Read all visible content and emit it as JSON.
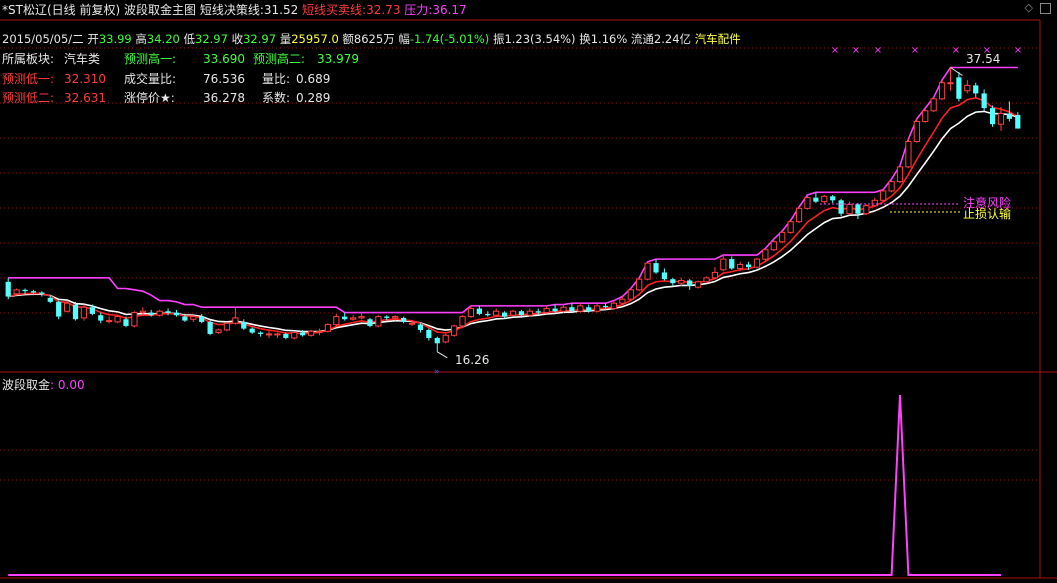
{
  "header": {
    "stock": "*ST松辽(日线 前复权)",
    "indicator": "波段取金主图",
    "decision_label": "短线决策线:",
    "decision_value": "31.52",
    "buysell_label": "短线买卖线:",
    "buysell_value": "32.73",
    "pressure_label": "压力:",
    "pressure_value": "36.17"
  },
  "quote": {
    "date": "2015/05/05/二",
    "open_label": "开",
    "open": "33.99",
    "high_label": "高",
    "high": "34.20",
    "low_label": "低",
    "low": "32.97",
    "close_label": "收",
    "close": "32.97",
    "volume_label": "量",
    "volume": "25957.0",
    "amount_label": "额",
    "amount": "8625万",
    "change_label": "幅",
    "change": "-1.74(-5.01%)",
    "amplitude_label": "振",
    "amplitude": "1.23(3.54%)",
    "turnover_label": "换",
    "turnover": "1.16%",
    "float_label": "流通",
    "float": "2.24亿",
    "sector": "汽车配件"
  },
  "info": {
    "board_label": "所属板块:",
    "board": "汽车类",
    "pred_high1_label": "预测高一:",
    "pred_high1": "33.690",
    "pred_high2_label": "预测高二:",
    "pred_high2": "33.979",
    "pred_low1_label": "预测低一:",
    "pred_low1": "32.310",
    "volratio_label": "成交量比:",
    "volratio": "76.536",
    "qb_label": "量比:",
    "qb": "0.689",
    "pred_low2_label": "预测低二:",
    "pred_low2": "32.631",
    "limitup_label": "涨停价★:",
    "limitup": "36.278",
    "coef_label": "系数:",
    "coef": "0.289"
  },
  "annotations": {
    "max_price": "37.54",
    "min_price": "16.26",
    "risk": "注意风险",
    "stoploss": "止损认输"
  },
  "sub_panel": {
    "label": "波段取金",
    "value": ": 0.00"
  },
  "colors": {
    "up": "#ff4040",
    "down": "#54ffff",
    "pressure_line": "#ff40ff",
    "buysell_line": "#ff2020",
    "decision_line": "#ffffff",
    "signal_line": "#ff40ff"
  },
  "chart_data": {
    "type": "candlestick",
    "ylim": [
      15.5,
      39
    ],
    "candles": [
      {
        "o": 21.5,
        "c": 20.4,
        "h": 21.8,
        "l": 20.2
      },
      {
        "o": 20.6,
        "c": 20.9,
        "h": 21.0,
        "l": 20.5
      },
      {
        "o": 20.9,
        "c": 20.8,
        "h": 21.0,
        "l": 20.6
      },
      {
        "o": 20.8,
        "c": 20.7,
        "h": 20.9,
        "l": 20.5
      },
      {
        "o": 20.7,
        "c": 20.6,
        "h": 20.8,
        "l": 20.4
      },
      {
        "o": 20.3,
        "c": 20.0,
        "h": 20.5,
        "l": 19.9
      },
      {
        "o": 20.0,
        "c": 18.9,
        "h": 20.1,
        "l": 18.7
      },
      {
        "o": 19.3,
        "c": 19.9,
        "h": 20.1,
        "l": 19.2
      },
      {
        "o": 19.8,
        "c": 18.7,
        "h": 20.0,
        "l": 18.6
      },
      {
        "o": 18.8,
        "c": 19.6,
        "h": 19.8,
        "l": 18.6
      },
      {
        "o": 19.6,
        "c": 19.1,
        "h": 19.8,
        "l": 19.0
      },
      {
        "o": 19.0,
        "c": 18.6,
        "h": 19.2,
        "l": 18.4
      },
      {
        "o": 18.6,
        "c": 18.6,
        "h": 18.9,
        "l": 18.4
      },
      {
        "o": 18.5,
        "c": 18.9,
        "h": 19.0,
        "l": 18.4
      },
      {
        "o": 18.7,
        "c": 18.2,
        "h": 18.9,
        "l": 18.1
      },
      {
        "o": 18.2,
        "c": 19.2,
        "h": 19.3,
        "l": 18.1
      },
      {
        "o": 19.2,
        "c": 19.3,
        "h": 19.6,
        "l": 19.0
      },
      {
        "o": 19.2,
        "c": 19.0,
        "h": 19.4,
        "l": 18.9
      },
      {
        "o": 19.0,
        "c": 19.3,
        "h": 19.4,
        "l": 18.9
      },
      {
        "o": 19.3,
        "c": 19.2,
        "h": 19.5,
        "l": 19.0
      },
      {
        "o": 19.2,
        "c": 19.0,
        "h": 19.4,
        "l": 18.9
      },
      {
        "o": 18.9,
        "c": 18.6,
        "h": 19.1,
        "l": 18.5
      },
      {
        "o": 18.7,
        "c": 18.9,
        "h": 19.0,
        "l": 18.5
      },
      {
        "o": 18.9,
        "c": 18.5,
        "h": 19.1,
        "l": 18.4
      },
      {
        "o": 18.5,
        "c": 17.6,
        "h": 18.6,
        "l": 17.5
      },
      {
        "o": 17.7,
        "c": 17.9,
        "h": 18.0,
        "l": 17.6
      },
      {
        "o": 17.9,
        "c": 18.4,
        "h": 18.5,
        "l": 17.8
      },
      {
        "o": 18.4,
        "c": 18.8,
        "h": 19.6,
        "l": 18.3
      },
      {
        "o": 18.5,
        "c": 18.0,
        "h": 18.7,
        "l": 17.9
      },
      {
        "o": 18.0,
        "c": 17.7,
        "h": 18.1,
        "l": 17.6
      },
      {
        "o": 17.7,
        "c": 17.6,
        "h": 17.8,
        "l": 17.4
      },
      {
        "o": 17.6,
        "c": 17.6,
        "h": 17.8,
        "l": 17.3
      },
      {
        "o": 17.6,
        "c": 17.6,
        "h": 17.7,
        "l": 17.3
      },
      {
        "o": 17.6,
        "c": 17.3,
        "h": 17.7,
        "l": 17.2
      },
      {
        "o": 17.3,
        "c": 17.7,
        "h": 17.8,
        "l": 17.2
      },
      {
        "o": 17.7,
        "c": 17.5,
        "h": 17.9,
        "l": 17.4
      },
      {
        "o": 17.5,
        "c": 17.8,
        "h": 17.9,
        "l": 17.4
      },
      {
        "o": 17.8,
        "c": 17.8,
        "h": 18.0,
        "l": 17.5
      },
      {
        "o": 17.8,
        "c": 18.3,
        "h": 18.4,
        "l": 17.7
      },
      {
        "o": 18.3,
        "c": 18.9,
        "h": 19.1,
        "l": 18.2
      },
      {
        "o": 18.9,
        "c": 18.7,
        "h": 19.2,
        "l": 18.6
      },
      {
        "o": 18.7,
        "c": 18.8,
        "h": 19.0,
        "l": 18.6
      },
      {
        "o": 18.8,
        "c": 18.9,
        "h": 19.2,
        "l": 18.7
      },
      {
        "o": 18.7,
        "c": 18.2,
        "h": 18.8,
        "l": 18.1
      },
      {
        "o": 18.2,
        "c": 18.9,
        "h": 19.0,
        "l": 18.1
      },
      {
        "o": 18.9,
        "c": 18.8,
        "h": 19.0,
        "l": 18.6
      },
      {
        "o": 18.8,
        "c": 18.9,
        "h": 19.0,
        "l": 18.6
      },
      {
        "o": 18.8,
        "c": 18.5,
        "h": 18.9,
        "l": 18.4
      },
      {
        "o": 18.4,
        "c": 18.4,
        "h": 18.6,
        "l": 18.2
      },
      {
        "o": 18.3,
        "c": 17.9,
        "h": 18.4,
        "l": 17.7
      },
      {
        "o": 17.9,
        "c": 17.3,
        "h": 18.0,
        "l": 17.1
      },
      {
        "o": 17.3,
        "c": 16.9,
        "h": 17.4,
        "l": 16.26
      },
      {
        "o": 17.0,
        "c": 17.5,
        "h": 17.6,
        "l": 16.9
      },
      {
        "o": 17.5,
        "c": 18.2,
        "h": 18.3,
        "l": 17.4
      },
      {
        "o": 18.2,
        "c": 18.9,
        "h": 19.0,
        "l": 18.1
      },
      {
        "o": 18.9,
        "c": 19.5,
        "h": 19.7,
        "l": 18.8
      },
      {
        "o": 19.5,
        "c": 19.1,
        "h": 19.7,
        "l": 19.0
      },
      {
        "o": 19.1,
        "c": 19.0,
        "h": 19.3,
        "l": 18.9
      },
      {
        "o": 19.0,
        "c": 19.3,
        "h": 19.5,
        "l": 18.9
      },
      {
        "o": 19.2,
        "c": 18.9,
        "h": 19.3,
        "l": 18.8
      },
      {
        "o": 19.0,
        "c": 19.3,
        "h": 19.4,
        "l": 18.9
      },
      {
        "o": 19.3,
        "c": 19.0,
        "h": 19.4,
        "l": 18.9
      },
      {
        "o": 19.0,
        "c": 19.3,
        "h": 19.5,
        "l": 18.9
      },
      {
        "o": 19.3,
        "c": 19.2,
        "h": 19.5,
        "l": 19.0
      },
      {
        "o": 19.2,
        "c": 19.5,
        "h": 19.7,
        "l": 19.1
      },
      {
        "o": 19.5,
        "c": 19.3,
        "h": 19.8,
        "l": 19.2
      },
      {
        "o": 19.3,
        "c": 19.6,
        "h": 19.8,
        "l": 19.2
      },
      {
        "o": 19.6,
        "c": 19.3,
        "h": 19.9,
        "l": 19.2
      },
      {
        "o": 19.3,
        "c": 19.7,
        "h": 19.9,
        "l": 19.2
      },
      {
        "o": 19.6,
        "c": 19.3,
        "h": 19.8,
        "l": 19.2
      },
      {
        "o": 19.3,
        "c": 19.7,
        "h": 19.9,
        "l": 19.2
      },
      {
        "o": 19.7,
        "c": 19.6,
        "h": 19.9,
        "l": 19.4
      },
      {
        "o": 19.5,
        "c": 19.9,
        "h": 20.1,
        "l": 19.4
      },
      {
        "o": 19.9,
        "c": 20.2,
        "h": 20.4,
        "l": 19.8
      },
      {
        "o": 20.2,
        "c": 20.9,
        "h": 21.0,
        "l": 20.1
      },
      {
        "o": 20.9,
        "c": 21.7,
        "h": 21.8,
        "l": 20.8
      },
      {
        "o": 21.7,
        "c": 22.9,
        "h": 23.0,
        "l": 21.6
      },
      {
        "o": 22.9,
        "c": 22.2,
        "h": 23.2,
        "l": 22.1
      },
      {
        "o": 22.2,
        "c": 21.7,
        "h": 22.5,
        "l": 21.6
      },
      {
        "o": 21.7,
        "c": 21.4,
        "h": 21.8,
        "l": 21.2
      },
      {
        "o": 21.4,
        "c": 21.6,
        "h": 21.8,
        "l": 21.2
      },
      {
        "o": 21.6,
        "c": 21.2,
        "h": 21.7,
        "l": 20.9
      },
      {
        "o": 21.1,
        "c": 21.5,
        "h": 21.6,
        "l": 21.0
      },
      {
        "o": 21.5,
        "c": 21.8,
        "h": 21.9,
        "l": 21.4
      },
      {
        "o": 21.8,
        "c": 22.2,
        "h": 22.6,
        "l": 21.7
      },
      {
        "o": 22.4,
        "c": 23.2,
        "h": 23.5,
        "l": 22.3
      },
      {
        "o": 23.2,
        "c": 22.5,
        "h": 23.4,
        "l": 22.4
      },
      {
        "o": 22.5,
        "c": 22.8,
        "h": 23.0,
        "l": 22.3
      },
      {
        "o": 22.8,
        "c": 22.6,
        "h": 23.0,
        "l": 22.4
      },
      {
        "o": 22.6,
        "c": 23.2,
        "h": 23.3,
        "l": 22.5
      },
      {
        "o": 23.2,
        "c": 23.9,
        "h": 24.0,
        "l": 23.1
      },
      {
        "o": 23.9,
        "c": 24.5,
        "h": 24.7,
        "l": 23.8
      },
      {
        "o": 24.5,
        "c": 25.2,
        "h": 25.3,
        "l": 24.4
      },
      {
        "o": 25.2,
        "c": 26.0,
        "h": 26.1,
        "l": 25.1
      },
      {
        "o": 26.0,
        "c": 27.0,
        "h": 27.1,
        "l": 25.9
      },
      {
        "o": 27.0,
        "c": 27.8,
        "h": 28.0,
        "l": 26.9
      },
      {
        "o": 27.8,
        "c": 27.5,
        "h": 28.2,
        "l": 27.4
      },
      {
        "o": 27.5,
        "c": 27.9,
        "h": 28.0,
        "l": 27.3
      },
      {
        "o": 27.9,
        "c": 27.6,
        "h": 28.0,
        "l": 27.4
      },
      {
        "o": 27.6,
        "c": 26.6,
        "h": 27.7,
        "l": 26.4
      },
      {
        "o": 26.6,
        "c": 27.3,
        "h": 27.5,
        "l": 26.5
      },
      {
        "o": 27.3,
        "c": 26.6,
        "h": 27.4,
        "l": 26.2
      },
      {
        "o": 26.6,
        "c": 27.2,
        "h": 27.3,
        "l": 26.5
      },
      {
        "o": 27.2,
        "c": 27.6,
        "h": 27.8,
        "l": 27.1
      },
      {
        "o": 27.6,
        "c": 28.3,
        "h": 28.4,
        "l": 27.5
      },
      {
        "o": 28.3,
        "c": 29.0,
        "h": 29.2,
        "l": 28.2
      },
      {
        "o": 29.0,
        "c": 30.1,
        "h": 30.2,
        "l": 28.9
      },
      {
        "o": 30.1,
        "c": 32.0,
        "h": 32.2,
        "l": 30.0
      },
      {
        "o": 32.0,
        "c": 33.5,
        "h": 33.7,
        "l": 31.9
      },
      {
        "o": 33.5,
        "c": 34.3,
        "h": 34.5,
        "l": 33.4
      },
      {
        "o": 34.3,
        "c": 35.2,
        "h": 35.3,
        "l": 34.2
      },
      {
        "o": 35.2,
        "c": 36.4,
        "h": 36.6,
        "l": 35.1
      },
      {
        "o": 36.4,
        "c": 36.4,
        "h": 37.54,
        "l": 35.8
      },
      {
        "o": 36.8,
        "c": 35.2,
        "h": 37.2,
        "l": 35.0
      },
      {
        "o": 35.8,
        "c": 36.2,
        "h": 36.6,
        "l": 35.6
      },
      {
        "o": 36.2,
        "c": 35.6,
        "h": 36.4,
        "l": 35.3
      },
      {
        "o": 35.6,
        "c": 34.5,
        "h": 35.9,
        "l": 34.3
      },
      {
        "o": 34.5,
        "c": 33.3,
        "h": 34.7,
        "l": 33.1
      },
      {
        "o": 33.3,
        "c": 34.1,
        "h": 34.6,
        "l": 32.8
      },
      {
        "o": 34.1,
        "c": 33.7,
        "h": 35.0,
        "l": 33.5
      },
      {
        "o": 33.99,
        "c": 32.97,
        "h": 34.2,
        "l": 32.97
      }
    ],
    "signal": [
      0,
      0,
      0,
      0,
      0,
      0,
      0,
      0,
      0,
      0,
      0,
      0,
      0,
      0,
      0,
      0,
      0,
      0,
      0,
      0,
      0,
      0,
      0,
      0,
      0,
      0,
      0,
      0,
      0,
      0,
      0,
      0,
      0,
      0,
      0,
      0,
      0,
      0,
      0,
      0,
      0,
      0,
      0,
      0,
      0,
      0,
      0,
      0,
      0,
      0,
      0,
      0,
      0,
      0,
      0,
      0,
      0,
      0,
      0,
      0,
      0,
      0,
      0,
      0,
      0,
      0,
      0,
      0,
      0,
      0,
      0,
      0,
      0,
      0,
      0,
      0,
      0,
      0,
      0,
      0,
      0,
      0,
      0,
      0,
      0,
      0,
      0,
      0,
      0,
      0,
      0,
      0,
      0,
      0,
      0,
      0,
      0,
      0,
      0,
      0,
      0,
      0,
      0,
      0,
      0,
      0,
      1,
      0,
      0,
      0,
      0,
      0,
      0,
      0,
      0,
      0,
      0,
      0,
      0
    ],
    "signal_ylim": [
      0,
      1
    ]
  }
}
